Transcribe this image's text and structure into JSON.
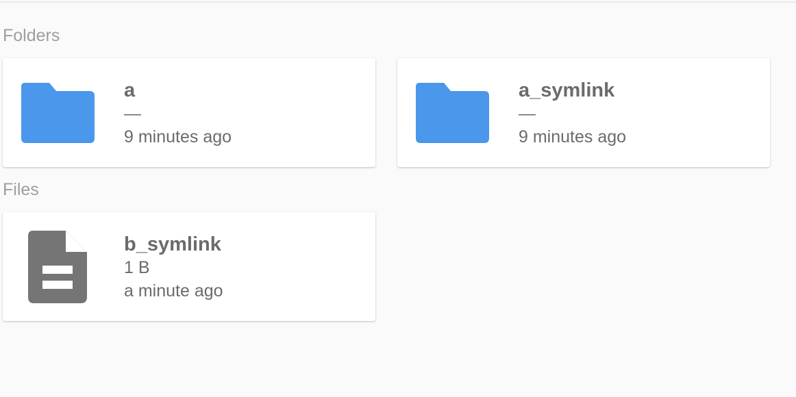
{
  "sections": {
    "folders_title": "Folders",
    "files_title": "Files"
  },
  "folders": [
    {
      "name": "a",
      "size": "—",
      "modified": "9 minutes ago",
      "icon": "folder-icon"
    },
    {
      "name": "a_symlink",
      "size": "—",
      "modified": "9 minutes ago",
      "icon": "folder-icon"
    }
  ],
  "files": [
    {
      "name": "b_symlink",
      "size": "1 B",
      "modified": "a minute ago",
      "icon": "file-icon"
    }
  ],
  "colors": {
    "folder": "#4a97ec",
    "file": "#757575",
    "text": "#6b6b6b",
    "section_title": "#9e9e9e"
  }
}
